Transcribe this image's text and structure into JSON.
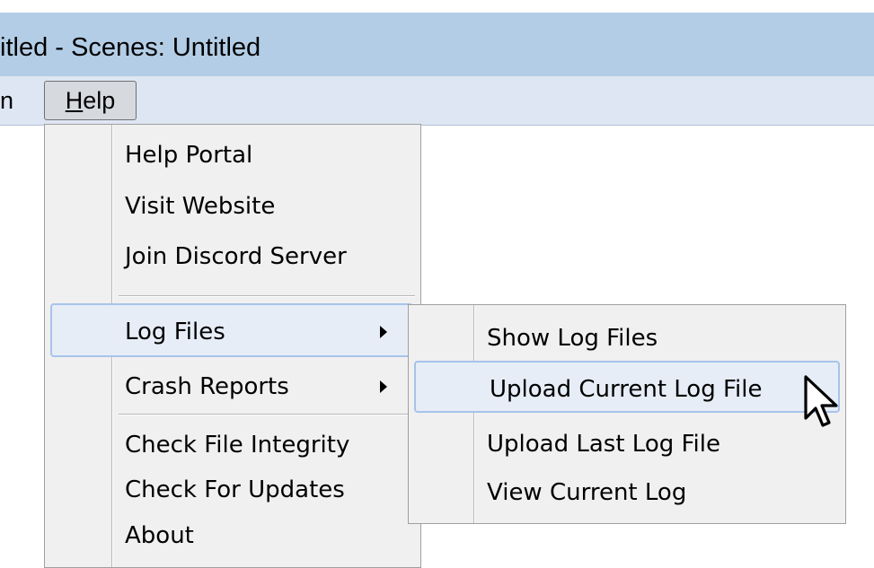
{
  "title_bar": {
    "text": "itled - Scenes: Untitled"
  },
  "menubar": {
    "fragment": "n",
    "help_label": "Help",
    "help_mnemonic": "H",
    "help_rest": "elp"
  },
  "help_menu": {
    "items": [
      {
        "label": "Help Portal"
      },
      {
        "label": "Visit Website"
      },
      {
        "label": "Join Discord Server"
      },
      {
        "label": "Log Files",
        "has_submenu": true,
        "highlighted": true
      },
      {
        "label": "Crash Reports",
        "has_submenu": true
      },
      {
        "label": "Check File Integrity"
      },
      {
        "label": "Check For Updates"
      },
      {
        "label": "About"
      }
    ]
  },
  "log_files_submenu": {
    "items": [
      {
        "label": "Show Log Files"
      },
      {
        "label": "Upload Current Log File",
        "highlighted": true
      },
      {
        "label": "Upload Last Log File"
      },
      {
        "label": "View Current Log"
      }
    ]
  },
  "icons": {
    "submenu_arrow": "triangle-right-icon",
    "cursor": "mouse-pointer-icon"
  },
  "colors": {
    "title_bar": "#b3cde6",
    "menubar": "#dfe6f3",
    "menu_bg": "#f0f0f0",
    "highlight_border": "#a7c3ea",
    "highlight_bg": "#e6edf7"
  }
}
